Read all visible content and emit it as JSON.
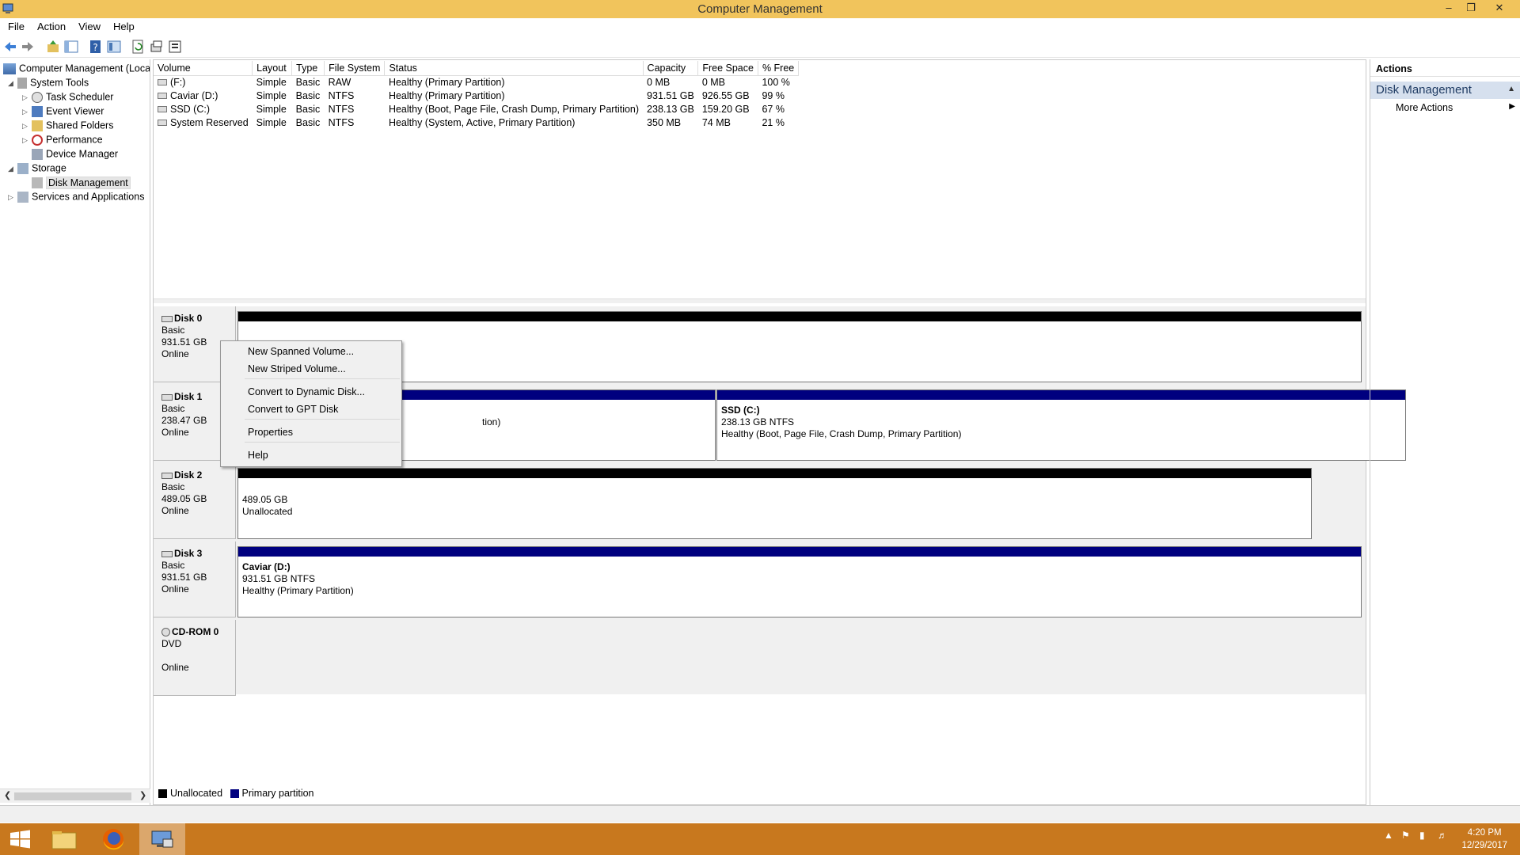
{
  "window": {
    "title": "Computer Management"
  },
  "menu": [
    "File",
    "Action",
    "View",
    "Help"
  ],
  "tree": {
    "root": "Computer Management (Local",
    "system_tools": "System Tools",
    "task_scheduler": "Task Scheduler",
    "event_viewer": "Event Viewer",
    "shared_folders": "Shared Folders",
    "performance": "Performance",
    "device_manager": "Device Manager",
    "storage": "Storage",
    "disk_management": "Disk Management",
    "services": "Services and Applications"
  },
  "volumes": {
    "columns": [
      "Volume",
      "Layout",
      "Type",
      "File System",
      "Status",
      "Capacity",
      "Free Space",
      "% Free"
    ],
    "rows": [
      [
        "(F:)",
        "Simple",
        "Basic",
        "RAW",
        "Healthy (Primary Partition)",
        "0 MB",
        "0 MB",
        "100 %"
      ],
      [
        "Caviar (D:)",
        "Simple",
        "Basic",
        "NTFS",
        "Healthy (Primary Partition)",
        "931.51 GB",
        "926.55 GB",
        "99 %"
      ],
      [
        "SSD (C:)",
        "Simple",
        "Basic",
        "NTFS",
        "Healthy (Boot, Page File, Crash Dump, Primary Partition)",
        "238.13 GB",
        "159.20 GB",
        "67 %"
      ],
      [
        "System Reserved",
        "Simple",
        "Basic",
        "NTFS",
        "Healthy (System, Active, Primary Partition)",
        "350 MB",
        "74 MB",
        "21 %"
      ]
    ]
  },
  "disks": {
    "disk0": {
      "name": "Disk 0",
      "type": "Basic",
      "size": "931.51 GB",
      "state": "Online"
    },
    "disk1": {
      "name": "Disk 1",
      "type": "Basic",
      "size": "238.47 GB",
      "state": "Online",
      "part_a_tail": "tion)",
      "ssd": {
        "name": "SSD  (C:)",
        "size": "238.13 GB NTFS",
        "status": "Healthy (Boot, Page File, Crash Dump, Primary Partition)"
      }
    },
    "disk2": {
      "name": "Disk 2",
      "type": "Basic",
      "size": "489.05 GB",
      "state": "Online",
      "unalloc": {
        "size": "489.05 GB",
        "label": "Unallocated"
      }
    },
    "disk3": {
      "name": "Disk 3",
      "type": "Basic",
      "size": "931.51 GB",
      "state": "Online",
      "caviar": {
        "name": "Caviar  (D:)",
        "size": "931.51 GB NTFS",
        "status": "Healthy (Primary Partition)"
      }
    },
    "cdrom0": {
      "name": "CD-ROM 0",
      "type": "DVD",
      "state": "Online"
    }
  },
  "legend": {
    "unallocated": "Unallocated",
    "primary": "Primary partition"
  },
  "context_menu": {
    "spanned": "New Spanned Volume...",
    "striped": "New Striped Volume...",
    "dynamic": "Convert to Dynamic Disk...",
    "gpt": "Convert to GPT Disk",
    "properties": "Properties",
    "help": "Help"
  },
  "actions": {
    "header": "Actions",
    "section": "Disk Management",
    "more": "More Actions"
  },
  "clock": {
    "time": "4:20 PM",
    "date": "12/29/2017"
  },
  "colors": {
    "unallocated": "#000000",
    "primary": "#00007f",
    "titlebar": "#f1c45c",
    "taskbar": "#c8781e"
  },
  "icons": [
    "back-icon",
    "forward-icon",
    "up-icon",
    "show-hide-tree-icon",
    "help-icon",
    "console-icon",
    "refresh-icon",
    "rescan-icon",
    "settings-icon",
    "windows-start-icon",
    "file-explorer-icon",
    "firefox-icon",
    "computer-management-icon"
  ]
}
